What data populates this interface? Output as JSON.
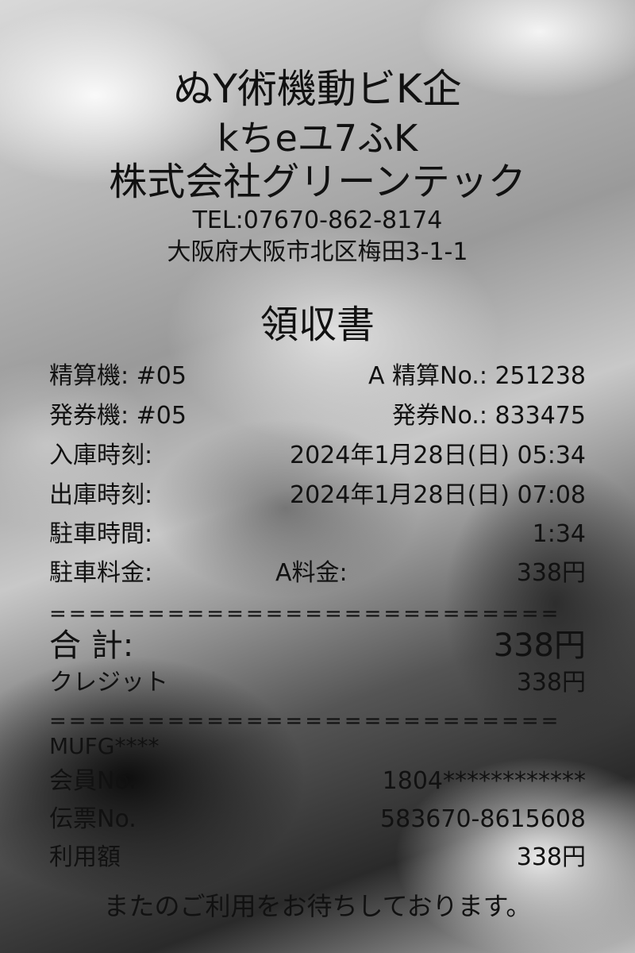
{
  "header": {
    "line1": "ぬY術機動ビK企",
    "line2": "kちeユ7ふK",
    "company": "株式会社グリーンテック",
    "tel": "TEL:07670-862-8174",
    "address": "大阪府大阪市北区梅田3-1-1"
  },
  "title": "領収書",
  "details": {
    "machine_label": "精算機: #05",
    "seisan_no_label": "A 精算No.: 251238",
    "ticket_machine_label": "発券機: #05",
    "ticket_no_label": "発券No.: 833475",
    "entry_label": "入庫時刻:",
    "entry_value": "2024年1月28日(日) 05:34",
    "exit_label": "出庫時刻:",
    "exit_value": "2024年1月28日(日) 07:08",
    "duration_label": "駐車時間:",
    "duration_value": "1:34",
    "fee_label": "駐車料金:",
    "fee_type": "A料金:",
    "fee_value": "338円"
  },
  "separator": "==========================",
  "totals": {
    "total_label": "合 計:",
    "total_value": "338円",
    "credit_label": "クレジット",
    "credit_value": "338円"
  },
  "card": {
    "brand": "MUFG****",
    "member_label": "会員No.",
    "member_value": "1804************",
    "slip_label": "伝票No.",
    "slip_value": "583670-8615608",
    "amount_label": "利用額",
    "amount_value": "338円"
  },
  "footer": "またのご利用をお待ちしております。"
}
